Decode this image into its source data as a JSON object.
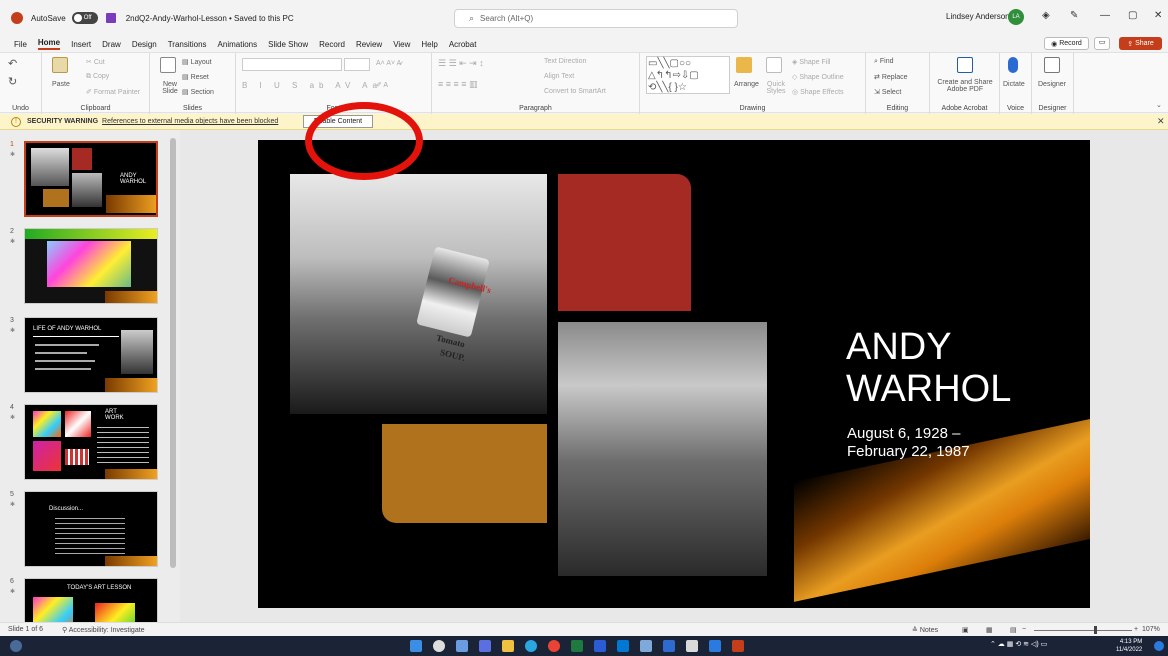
{
  "titlebar": {
    "autosave_label": "AutoSave",
    "autosave_state": "Off",
    "document_title": "2ndQ2-Andy-Warhol-Lesson • Saved to this PC",
    "search_placeholder": "Search (Alt+Q)",
    "user_name": "Lindsey Anderson",
    "user_initials": "LA"
  },
  "menu": {
    "tabs": [
      "File",
      "Home",
      "Insert",
      "Draw",
      "Design",
      "Transitions",
      "Animations",
      "Slide Show",
      "Record",
      "Review",
      "View",
      "Help",
      "Acrobat"
    ],
    "active": "Home",
    "record_label": "Record",
    "share_label": "Share"
  },
  "ribbon": {
    "groups": {
      "undo": "Undo",
      "clipboard": "Clipboard",
      "slides": "Slides",
      "font": "Font",
      "paragraph": "Paragraph",
      "drawing": "Drawing",
      "editing": "Editing",
      "adobe": "Adobe Acrobat",
      "voice": "Voice",
      "designer": "Designer"
    },
    "paste": "Paste",
    "cut": "Cut",
    "copy": "Copy",
    "format_painter": "Format Painter",
    "new_slide": "New Slide",
    "layout": "Layout",
    "reset": "Reset",
    "section": "Section",
    "text_direction": "Text Direction",
    "align_text": "Align Text",
    "convert_smartart": "Convert to SmartArt",
    "arrange": "Arrange",
    "quick_styles": "Quick Styles",
    "shape_fill": "Shape Fill",
    "shape_outline": "Shape Outline",
    "shape_effects": "Shape Effects",
    "find": "Find",
    "replace": "Replace",
    "select": "Select",
    "create_share_pdf": "Create and Share Adobe PDF",
    "dictate": "Dictate",
    "designer_btn": "Designer"
  },
  "security": {
    "title": "SECURITY WARNING",
    "message": "References to external media objects have been blocked",
    "button": "Enable Content"
  },
  "thumbnails": [
    {
      "num": "1",
      "title": "ANDY WARHOL"
    },
    {
      "num": "2",
      "title": ""
    },
    {
      "num": "3",
      "title": "LIFE OF ANDY WARHOL"
    },
    {
      "num": "4",
      "title": "ART WORK"
    },
    {
      "num": "5",
      "title": "Discussion..."
    },
    {
      "num": "6",
      "title": "TODAY'S ART LESSON"
    }
  ],
  "slide": {
    "title_line1": "ANDY",
    "title_line2": "WARHOL",
    "dates_line1": "August 6, 1928 –",
    "dates_line2": "February 22, 1987",
    "can_text_1": "Campbell's",
    "can_text_2": "Tomato",
    "can_text_3": "SOUP."
  },
  "status": {
    "slide_info": "Slide 1 of 6",
    "accessibility": "Accessibility: Investigate",
    "notes": "Notes",
    "zoom": "107%"
  },
  "taskbar": {
    "time": "4:13 PM",
    "date": "11/4/2022"
  },
  "colors": {
    "accent": "#c43e1c",
    "slide_red": "#a52a24",
    "slide_brown": "#b0721d",
    "annotation": "#e3120b"
  }
}
